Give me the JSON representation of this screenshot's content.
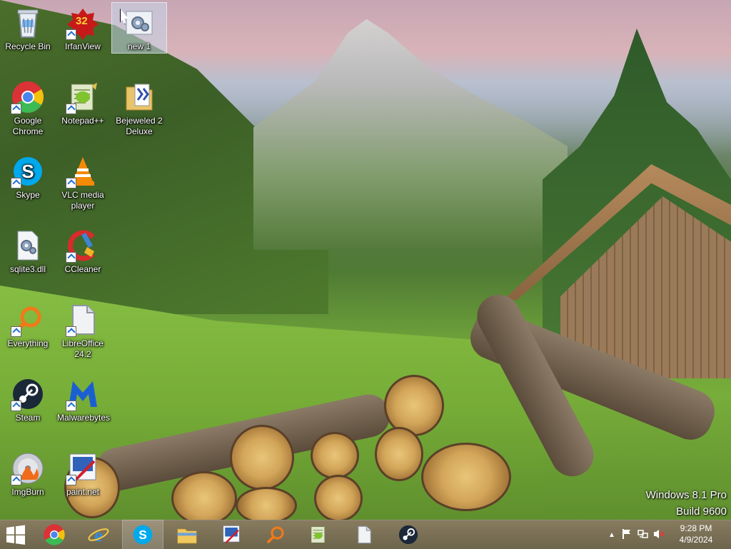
{
  "desktop": {
    "icons": [
      {
        "id": "recycle-bin",
        "label": "Recycle Bin",
        "icon": "recycle-bin-icon",
        "shortcut": false
      },
      {
        "id": "irfanview",
        "label": "IrfanView",
        "icon": "irfanview-icon",
        "badge": "32",
        "shortcut": true
      },
      {
        "id": "new1",
        "label": "new 1",
        "icon": "settings-file-icon",
        "shortcut": false,
        "selected": true
      },
      {
        "id": "chrome",
        "label": "Google Chrome",
        "icon": "chrome-icon",
        "shortcut": true
      },
      {
        "id": "notepadpp",
        "label": "Notepad++",
        "icon": "notepadpp-icon",
        "shortcut": true
      },
      {
        "id": "bejeweled",
        "label": "Bejeweled 2 Deluxe",
        "icon": "folder-icon",
        "shortcut": false
      },
      {
        "id": "skype",
        "label": "Skype",
        "icon": "skype-icon",
        "shortcut": true
      },
      {
        "id": "vlc",
        "label": "VLC media player",
        "icon": "vlc-icon",
        "shortcut": true
      },
      {
        "id": "sqlite",
        "label": "sqlite3.dll",
        "icon": "dll-file-icon",
        "shortcut": false
      },
      {
        "id": "ccleaner",
        "label": "CCleaner",
        "icon": "ccleaner-icon",
        "shortcut": true
      },
      {
        "id": "everything",
        "label": "Everything",
        "icon": "everything-search-icon",
        "shortcut": true
      },
      {
        "id": "libreoffice",
        "label": "LibreOffice 24.2",
        "icon": "libreoffice-icon",
        "shortcut": true
      },
      {
        "id": "steam",
        "label": "Steam",
        "icon": "steam-icon",
        "shortcut": true
      },
      {
        "id": "malwarebytes",
        "label": "Malwarebytes",
        "icon": "malwarebytes-icon",
        "shortcut": true
      },
      {
        "id": "imgburn",
        "label": "ImgBurn",
        "icon": "imgburn-icon",
        "shortcut": true
      },
      {
        "id": "paintnet",
        "label": "paint.net",
        "icon": "paintnet-icon",
        "shortcut": true
      }
    ]
  },
  "watermark": {
    "line1": "Windows 8.1 Pro",
    "line2": "Build 9600"
  },
  "taskbar": {
    "items": [
      {
        "name": "start-button",
        "icon": "windows-logo-icon"
      },
      {
        "name": "taskbar-chrome",
        "icon": "chrome-icon"
      },
      {
        "name": "taskbar-ie",
        "icon": "internet-explorer-icon"
      },
      {
        "name": "taskbar-skype",
        "icon": "skype-icon",
        "active": true
      },
      {
        "name": "taskbar-file-explorer",
        "icon": "folder-icon"
      },
      {
        "name": "taskbar-paintnet",
        "icon": "paintnet-icon"
      },
      {
        "name": "taskbar-everything",
        "icon": "everything-search-icon"
      },
      {
        "name": "taskbar-notepadpp",
        "icon": "notepadpp-icon"
      },
      {
        "name": "taskbar-libreoffice",
        "icon": "libreoffice-icon"
      },
      {
        "name": "taskbar-steam",
        "icon": "steam-icon"
      }
    ],
    "tray": {
      "time": "9:28 PM",
      "date": "4/9/2024",
      "icons": [
        "show-hidden-icons-icon",
        "action-center-flag-icon",
        "network-icon",
        "volume-muted-icon"
      ]
    }
  }
}
